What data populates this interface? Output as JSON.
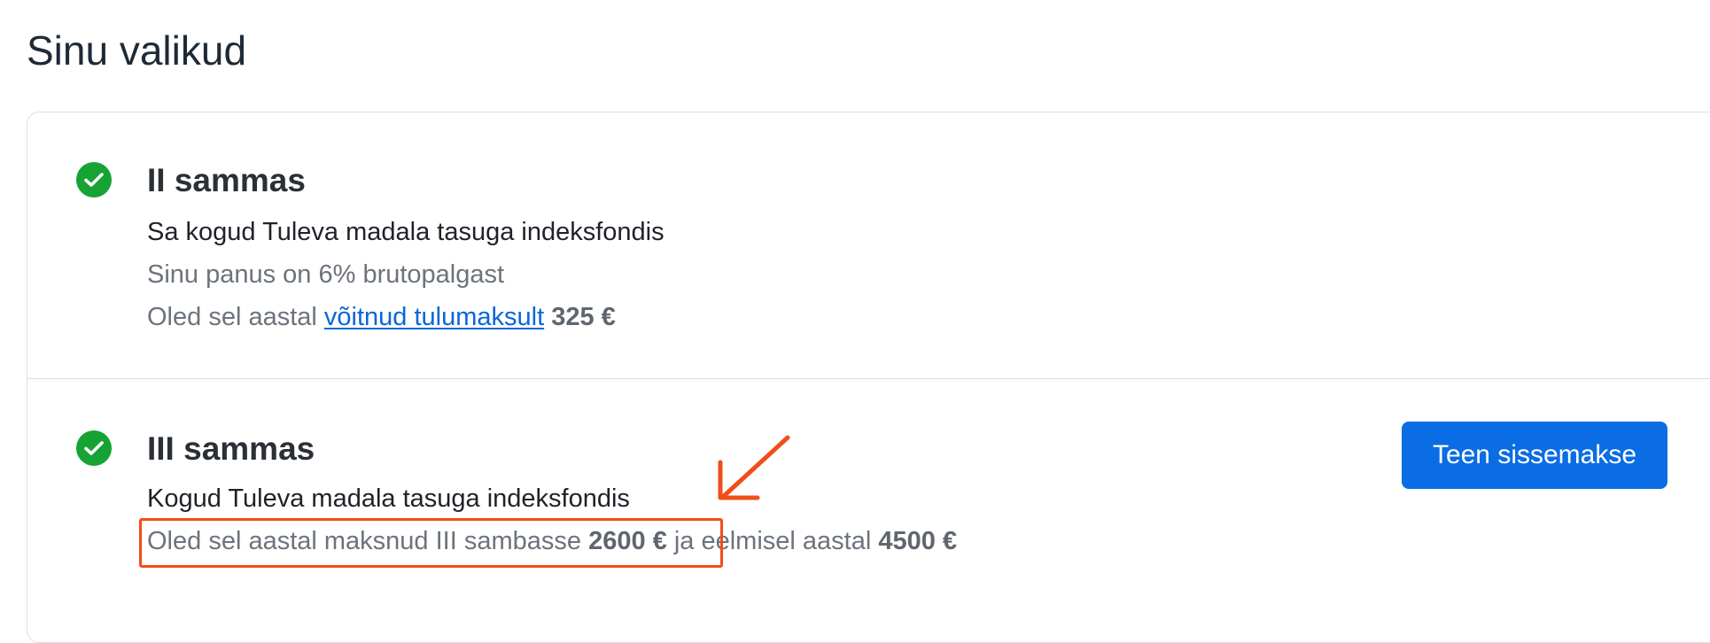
{
  "page": {
    "title": "Sinu valikud"
  },
  "pillar2": {
    "title": "II sammas",
    "status_icon": "check-circle-icon",
    "description": "Sa kogud Tuleva madala tasuga indeksfondis",
    "contribution": "Sinu panus on 6% brutopalgast",
    "tax_prefix": "Oled sel aastal",
    "tax_link": "võitnud tulumaksult",
    "tax_amount": "325 €"
  },
  "pillar3": {
    "title": "III sammas",
    "status_icon": "check-circle-icon",
    "description": "Kogud Tuleva madala tasuga indeksfondis",
    "paid_prefix": "Oled sel aastal maksnud III sambasse",
    "paid_amount": "2600 €",
    "prev_prefix": "ja eelmisel aastal",
    "prev_amount": "4500 €",
    "button_label": "Teen sissemakse"
  },
  "annotation": {
    "color": "#f04e19",
    "arrow_icon": "arrow-down-left-icon"
  },
  "colors": {
    "success": "#16a334",
    "primary": "#0a6de4",
    "link": "#0a66d8"
  }
}
